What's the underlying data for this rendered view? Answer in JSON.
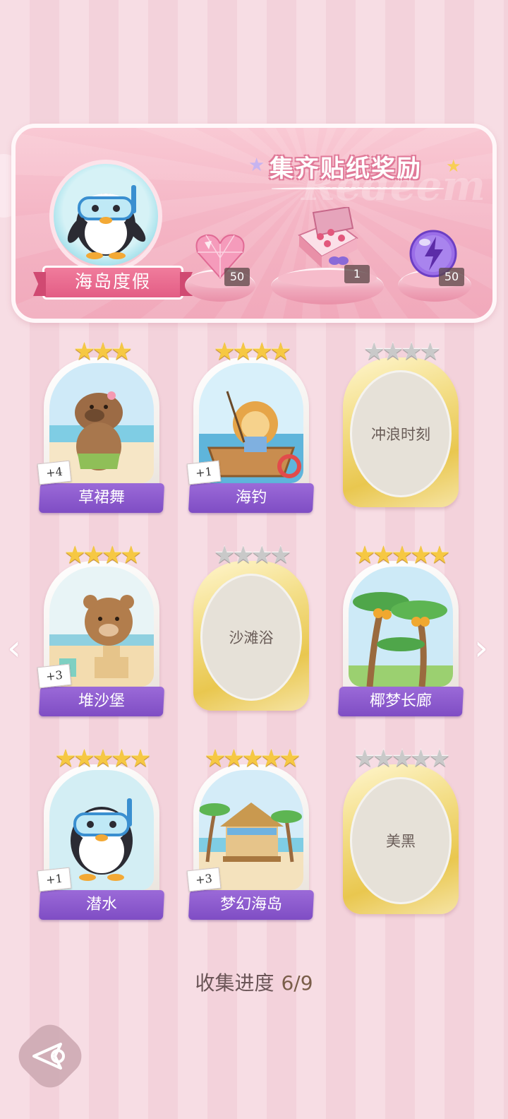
{
  "banner": {
    "title": "集齐贴纸奖励",
    "watermark": "Redeem",
    "set_name": "海岛度假",
    "rewards": [
      {
        "icon": "pink-heart-gem-icon",
        "count": "50"
      },
      {
        "icon": "gift-box-icon",
        "count": "1"
      },
      {
        "icon": "purple-energy-orb-icon",
        "count": "50"
      }
    ]
  },
  "cards": [
    {
      "name": "草裙舞",
      "stars": 3,
      "max_stars": 3,
      "collected": true,
      "dup": "+4",
      "art": "capybara-hula-art"
    },
    {
      "name": "海钓",
      "stars": 4,
      "max_stars": 4,
      "collected": true,
      "dup": "+1",
      "art": "lion-fishing-boat-art"
    },
    {
      "name": "冲浪时刻",
      "stars": 0,
      "max_stars": 4,
      "collected": false
    },
    {
      "name": "堆沙堡",
      "stars": 4,
      "max_stars": 4,
      "collected": true,
      "dup": "+3",
      "art": "bear-sandcastle-art"
    },
    {
      "name": "沙滩浴",
      "stars": 0,
      "max_stars": 4,
      "collected": false
    },
    {
      "name": "椰梦长廊",
      "stars": 5,
      "max_stars": 5,
      "collected": true,
      "dup": "",
      "art": "palm-trees-art"
    },
    {
      "name": "潜水",
      "stars": 5,
      "max_stars": 5,
      "collected": true,
      "dup": "+1",
      "art": "penguin-snorkel-art"
    },
    {
      "name": "梦幻海岛",
      "stars": 5,
      "max_stars": 5,
      "collected": true,
      "dup": "+3",
      "art": "beach-hut-art"
    },
    {
      "name": "美黑",
      "stars": 0,
      "max_stars": 5,
      "collected": false
    }
  ],
  "progress": {
    "label": "收集进度",
    "value": "6/9"
  },
  "nav": {
    "prev": "‹",
    "next": "›"
  },
  "colors": {
    "accent": "#8b5bd0",
    "banner": "#f4b4c4",
    "gold": "#f6c843"
  }
}
